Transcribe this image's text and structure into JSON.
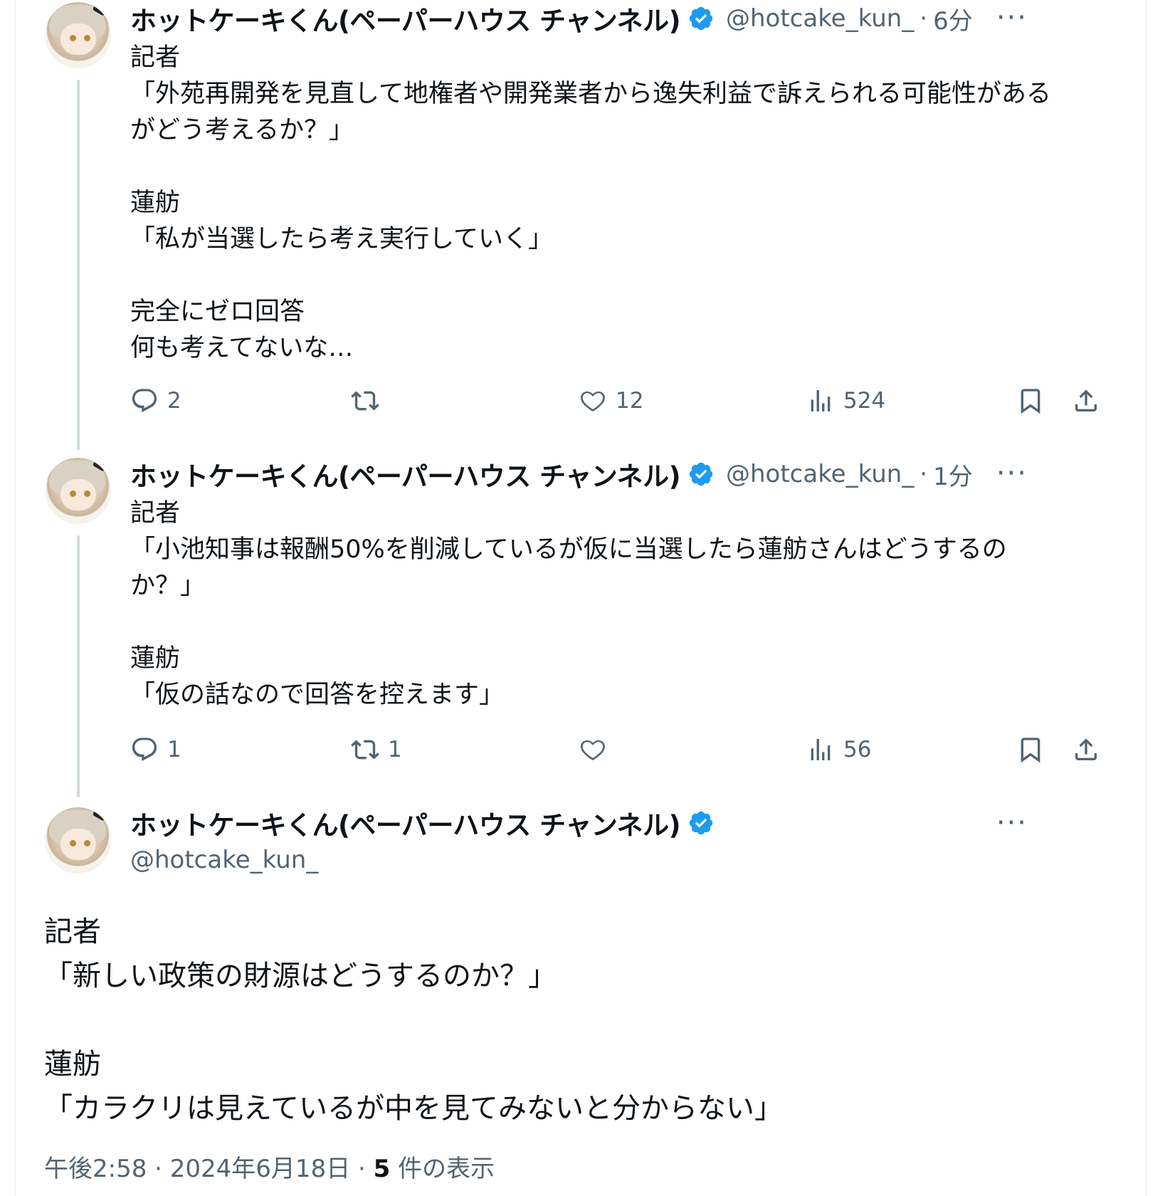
{
  "colors": {
    "text": "#0f1419",
    "muted": "#536471",
    "verified": "#1d9bf0",
    "thread_line": "#cfd9de"
  },
  "tweets": [
    {
      "name": "ホットケーキくん(ペーパーハウス チャンネル)",
      "handle": "@hotcake_kun_",
      "sep": "·",
      "time": "6分",
      "more": "···",
      "lines": [
        "記者",
        "「外苑再開発を見直して地権者や開発業者から逸失利益で訴えられる可能性がある",
        "がどう考えるか？」",
        "",
        "蓮舫",
        "「私が当選したら考え実行していく」",
        "",
        "完全にゼロ回答",
        "何も考えてないな…"
      ],
      "replies": "2",
      "retweets": "",
      "likes": "12",
      "views": "524"
    },
    {
      "name": "ホットケーキくん(ペーパーハウス チャンネル)",
      "handle": "@hotcake_kun_",
      "sep": "·",
      "time": "1分",
      "more": "···",
      "lines": [
        "記者",
        "「小池知事は報酬50%を削減しているが仮に当選したら蓮舫さんはどうするの",
        "か？」",
        "",
        "蓮舫",
        "「仮の話なので回答を控えます」"
      ],
      "replies": "1",
      "retweets": "1",
      "likes": "",
      "views": "56"
    }
  ],
  "main_tweet": {
    "name": "ホットケーキくん(ペーパーハウス チャンネル)",
    "handle": "@hotcake_kun_",
    "more": "···",
    "lines": [
      "記者",
      "「新しい政策の財源はどうするのか？」",
      "",
      "蓮舫",
      "「カラクリは見えているが中を見てみないと分からない」"
    ],
    "timestamp": "午後2:58 · 2024年6月18日 · ",
    "views_count": "5",
    "views_label": " 件の表示"
  },
  "icons": [
    "reply-icon",
    "retweet-icon",
    "like-icon",
    "views-icon",
    "bookmark-icon",
    "share-icon",
    "verified-icon",
    "more-icon"
  ]
}
